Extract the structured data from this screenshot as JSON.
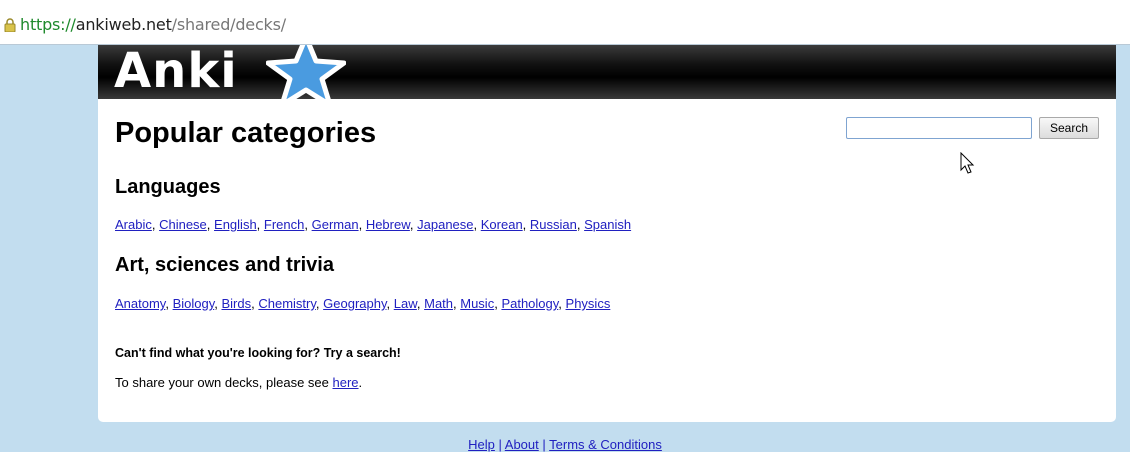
{
  "browser": {
    "url_scheme": "https://",
    "url_host": "ankiweb.net",
    "url_path": "/shared/decks/"
  },
  "header": {
    "logo_text": "Anki"
  },
  "main": {
    "title": "Popular categories",
    "languages": {
      "heading": "Languages",
      "items": [
        "Arabic",
        "Chinese",
        "English",
        "French",
        "German",
        "Hebrew",
        "Japanese",
        "Korean",
        "Russian",
        "Spanish"
      ]
    },
    "arts": {
      "heading": "Art, sciences and trivia",
      "items": [
        "Anatomy",
        "Biology",
        "Birds",
        "Chemistry",
        "Geography",
        "Law",
        "Math",
        "Music",
        "Pathology",
        "Physics"
      ]
    },
    "cant_find": "Can't find what you're looking for? Try a search!",
    "share_prefix": "To share your own decks, please see ",
    "share_link": "here",
    "share_suffix": "."
  },
  "search": {
    "value": "",
    "button_label": "Search"
  },
  "footer": {
    "links": [
      "Help",
      "About",
      "Terms & Conditions"
    ],
    "separator": " | "
  },
  "colors": {
    "page_bg": "#c2ddef",
    "link": "#2020c0",
    "header_bg": "#000000",
    "star": "#4a9be0"
  }
}
